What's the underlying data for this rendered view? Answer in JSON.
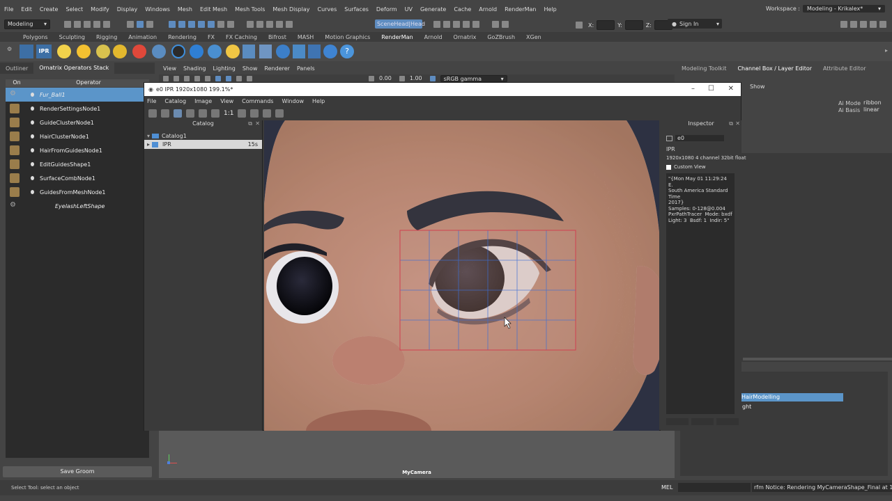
{
  "menubar": {
    "items": [
      "File",
      "Edit",
      "Create",
      "Select",
      "Modify",
      "Display",
      "Windows",
      "Mesh",
      "Edit Mesh",
      "Mesh Tools",
      "Mesh Display",
      "Curves",
      "Surfaces",
      "Deform",
      "UV",
      "Generate",
      "Cache",
      "Arnold",
      "RenderMan",
      "Help"
    ],
    "workspace_label": "Workspace :",
    "workspace_value": "Modeling - Krikalex*"
  },
  "toolbar": {
    "mode": "Modeling",
    "scene_field": "SceneHead|Head",
    "coord_x": "X:",
    "coord_y": "Y:",
    "coord_z": "Z:",
    "sign_in": "Sign In"
  },
  "shelf_tabs": [
    "Polygons",
    "Sculpting",
    "Rigging",
    "Animation",
    "Rendering",
    "FX",
    "FX Caching",
    "Bifrost",
    "MASH",
    "Motion Graphics",
    "RenderMan",
    "Arnold",
    "Ornatrix",
    "GoZBrush",
    "XGen"
  ],
  "shelf_active": "RenderMan",
  "shelf_ipr": "IPR",
  "left_panel": {
    "tabs": [
      "Outliner",
      "Ornatrix Operators Stack"
    ],
    "col_on": "On",
    "col_operator": "Operator",
    "operators": [
      {
        "name": "Fur_Ball1",
        "selected": true,
        "italic": true
      },
      {
        "name": "RenderSettingsNode1",
        "selected": false,
        "italic": false
      },
      {
        "name": "GuideClusterNode1",
        "selected": false,
        "italic": false
      },
      {
        "name": "HairClusterNode1",
        "selected": false,
        "italic": false
      },
      {
        "name": "HairFromGuidesNode1",
        "selected": false,
        "italic": false
      },
      {
        "name": "EditGuidesShape1",
        "selected": false,
        "italic": false
      },
      {
        "name": "SurfaceCombNode1",
        "selected": false,
        "italic": false
      },
      {
        "name": "GuidesFromMeshNode1",
        "selected": false,
        "italic": false
      },
      {
        "name": "EyelashLeftShape",
        "selected": false,
        "italic": true
      }
    ],
    "save_groom": "Save Groom"
  },
  "viewport": {
    "menu": [
      "View",
      "Shading",
      "Lighting",
      "Show",
      "Renderer",
      "Panels"
    ],
    "val1": "0.00",
    "val2": "1.00",
    "gamma": "sRGB gamma",
    "camera": "MyCamera"
  },
  "right_panel": {
    "tabs": [
      "Modeling Toolkit",
      "Channel Box / Layer Editor",
      "Attribute Editor"
    ],
    "show": "Show",
    "ai_mode_label": "Ai Mode",
    "ai_mode_value": "ribbon",
    "ai_basis_label": "Ai Basis",
    "ai_basis_value": "linear",
    "layer_name": "HairModelling",
    "layer_sub": "ght"
  },
  "statusbar": {
    "left": "Select Tool: select an object",
    "mel": "MEL",
    "notice": "rfm Notice: Rendering MyCameraShape_Final at 1"
  },
  "it_window": {
    "title": "e0 IPR 1920x1080 199.1%*",
    "menu": [
      "File",
      "Catalog",
      "Image",
      "View",
      "Commands",
      "Window",
      "Help"
    ],
    "ratio": "1:1",
    "catalog": {
      "header": "Catalog",
      "root": "Catalog1",
      "item": "IPR",
      "item_time": "15s"
    },
    "inspector": {
      "header": "Inspector",
      "name": "e0",
      "type": "IPR",
      "info": "1920x1080 4 channel 32bit float",
      "custom_view": "Custom View",
      "details": "\"{Mon May 01 11:29:24 E.\nSouth America Standard Time\n2017}\nSamples: 0-128@0.004\nPxrPathTracer  Mode: bxdf\nLight: 3  Bsdf: 1  Indir: 5\""
    }
  },
  "colors": {
    "accent": "#5b95c9",
    "skin": "#b98a78",
    "bucket": "#d04050"
  }
}
